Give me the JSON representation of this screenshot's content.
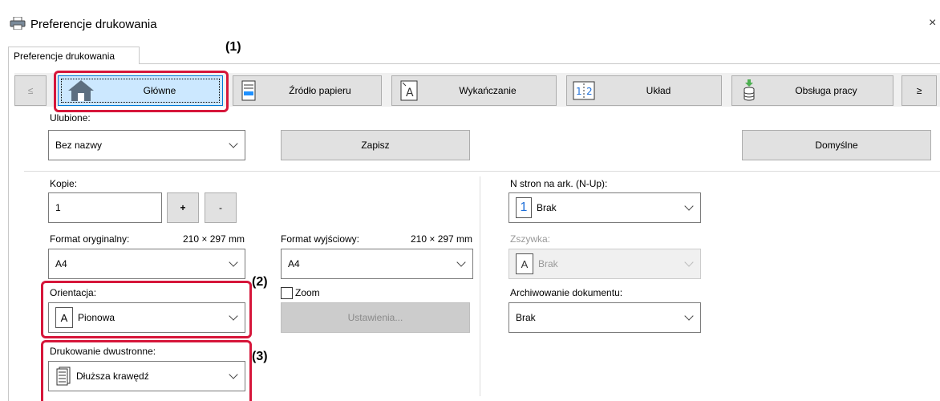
{
  "window": {
    "title": "Preferencje drukowania",
    "close": "×"
  },
  "tab": {
    "label": "Preferencje drukowania"
  },
  "nav": {
    "prev": "≤",
    "next": "≥",
    "items": [
      {
        "label": "Główne",
        "icon": "home-icon"
      },
      {
        "label": "Źródło papieru",
        "icon": "paper-tray-icon"
      },
      {
        "label": "Wykańczanie",
        "icon": "finishing-icon"
      },
      {
        "label": "Układ",
        "icon": "layout-icon"
      },
      {
        "label": "Obsługa pracy",
        "icon": "job-handling-icon"
      }
    ]
  },
  "favorites": {
    "label": "Ulubione:",
    "value": "Bez nazwy",
    "save": "Zapisz",
    "defaults": "Domyślne"
  },
  "copies": {
    "label": "Kopie:",
    "value": "1",
    "plus": "+",
    "minus": "-"
  },
  "original_size": {
    "label": "Format oryginalny:",
    "dims": "210 × 297 mm",
    "value": "A4"
  },
  "output_size": {
    "label": "Format wyjściowy:",
    "dims": "210 × 297 mm",
    "value": "A4"
  },
  "orientation": {
    "label": "Orientacja:",
    "value": "Pionowa"
  },
  "zoom": {
    "label": "Zoom",
    "settings": "Ustawienia..."
  },
  "duplex": {
    "label": "Drukowanie dwustronne:",
    "value": "Dłuższa krawędź"
  },
  "nup": {
    "label": "N stron na ark. (N-Up):",
    "value": "Brak",
    "icon_digit": "1"
  },
  "staple": {
    "label": "Zszywka:",
    "value": "Brak"
  },
  "archive": {
    "label": "Archiwowanie dokumentu:",
    "value": "Brak"
  },
  "callouts": {
    "c1": "(1)",
    "c2": "(2)",
    "c3": "(3)"
  },
  "colors": {
    "highlight": "#d6163a",
    "active_tab": "#cce8ff",
    "accent": "#0078d7"
  }
}
